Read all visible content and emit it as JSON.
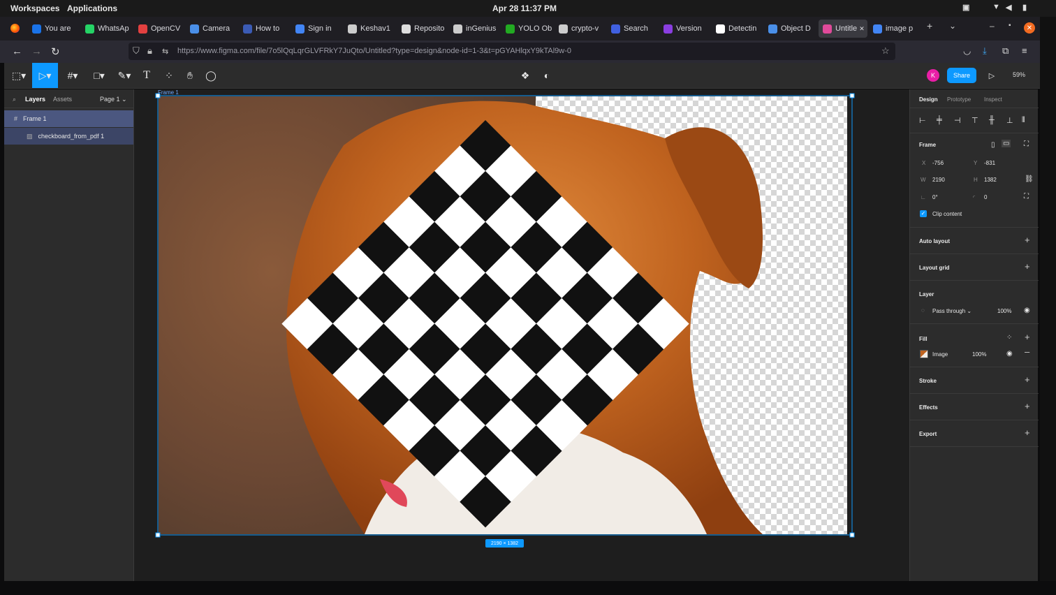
{
  "os": {
    "workspaces": "Workspaces",
    "applications": "Applications",
    "clock": "Apr 28  11:37 PM"
  },
  "tabs": [
    {
      "label": "You are",
      "icon": "s-icon",
      "color": "#1a73e8"
    },
    {
      "label": "WhatsAp",
      "icon": "whatsapp-icon",
      "color": "#25d366"
    },
    {
      "label": "OpenCV",
      "icon": "opencv-icon",
      "color": "#e34040"
    },
    {
      "label": "Camera",
      "icon": "chrome-icon",
      "color": "#4a8fe8"
    },
    {
      "label": "How to",
      "icon": "blog-icon",
      "color": "#3b5bb5"
    },
    {
      "label": "Sign in",
      "icon": "google-icon",
      "color": "#4285f4"
    },
    {
      "label": "Keshav1",
      "icon": "github-icon",
      "color": "#cccccc"
    },
    {
      "label": "Reposito",
      "icon": "doc-icon",
      "color": "#dddddd"
    },
    {
      "label": "inGenius",
      "icon": "github-icon",
      "color": "#cccccc"
    },
    {
      "label": "YOLO Ob",
      "icon": "yolo-icon",
      "color": "#22aa22"
    },
    {
      "label": "crypto-v",
      "icon": "github-icon",
      "color": "#cccccc"
    },
    {
      "label": "Search",
      "icon": "k-icon",
      "color": "#4060e0"
    },
    {
      "label": "Version",
      "icon": "version-icon",
      "color": "#8a3ee0"
    },
    {
      "label": "Detectin",
      "icon": "medium-icon",
      "color": "#ffffff"
    },
    {
      "label": "Object D",
      "icon": "chrome-icon",
      "color": "#4a8fe8"
    },
    {
      "label": "Untitle",
      "icon": "figma-icon",
      "color": "#e04a9a"
    },
    {
      "label": "image p",
      "icon": "google-icon",
      "color": "#4285f4"
    }
  ],
  "url": "https://www.figma.com/file/7o5lQqLqrGLVFRkY7JuQto/Untitled?type=design&node-id=1-3&t=pGYAHlqxY9kTAl9w-0",
  "figma": {
    "layers_tab": "Layers",
    "assets_tab": "Assets",
    "page": "Page 1",
    "layers": [
      "Frame 1",
      "checkboard_from_pdf 1"
    ],
    "share": "Share",
    "avatar": "K",
    "zoom": "59%",
    "frame_label": "Frame 1",
    "size_badge": "2190 × 1382",
    "help": "?"
  },
  "design": {
    "tabs": [
      "Design",
      "Prototype",
      "Inspect"
    ],
    "frame_title": "Frame",
    "x_label": "X",
    "x": "-756",
    "y_label": "Y",
    "y": "-831",
    "w_label": "W",
    "w": "2190",
    "h_label": "H",
    "h": "1382",
    "rotation": "0°",
    "radius": "0",
    "clip": "Clip content",
    "auto_layout": "Auto layout",
    "layout_grid": "Layout grid",
    "layer_title": "Layer",
    "blend": "Pass through",
    "layer_opacity": "100%",
    "fill_title": "Fill",
    "fill_type": "Image",
    "fill_opacity": "100%",
    "stroke": "Stroke",
    "effects": "Effects",
    "export": "Export"
  },
  "colors": {
    "accent": "#0d99ff",
    "panel": "#2c2c2c",
    "dog": "#b8551c"
  }
}
